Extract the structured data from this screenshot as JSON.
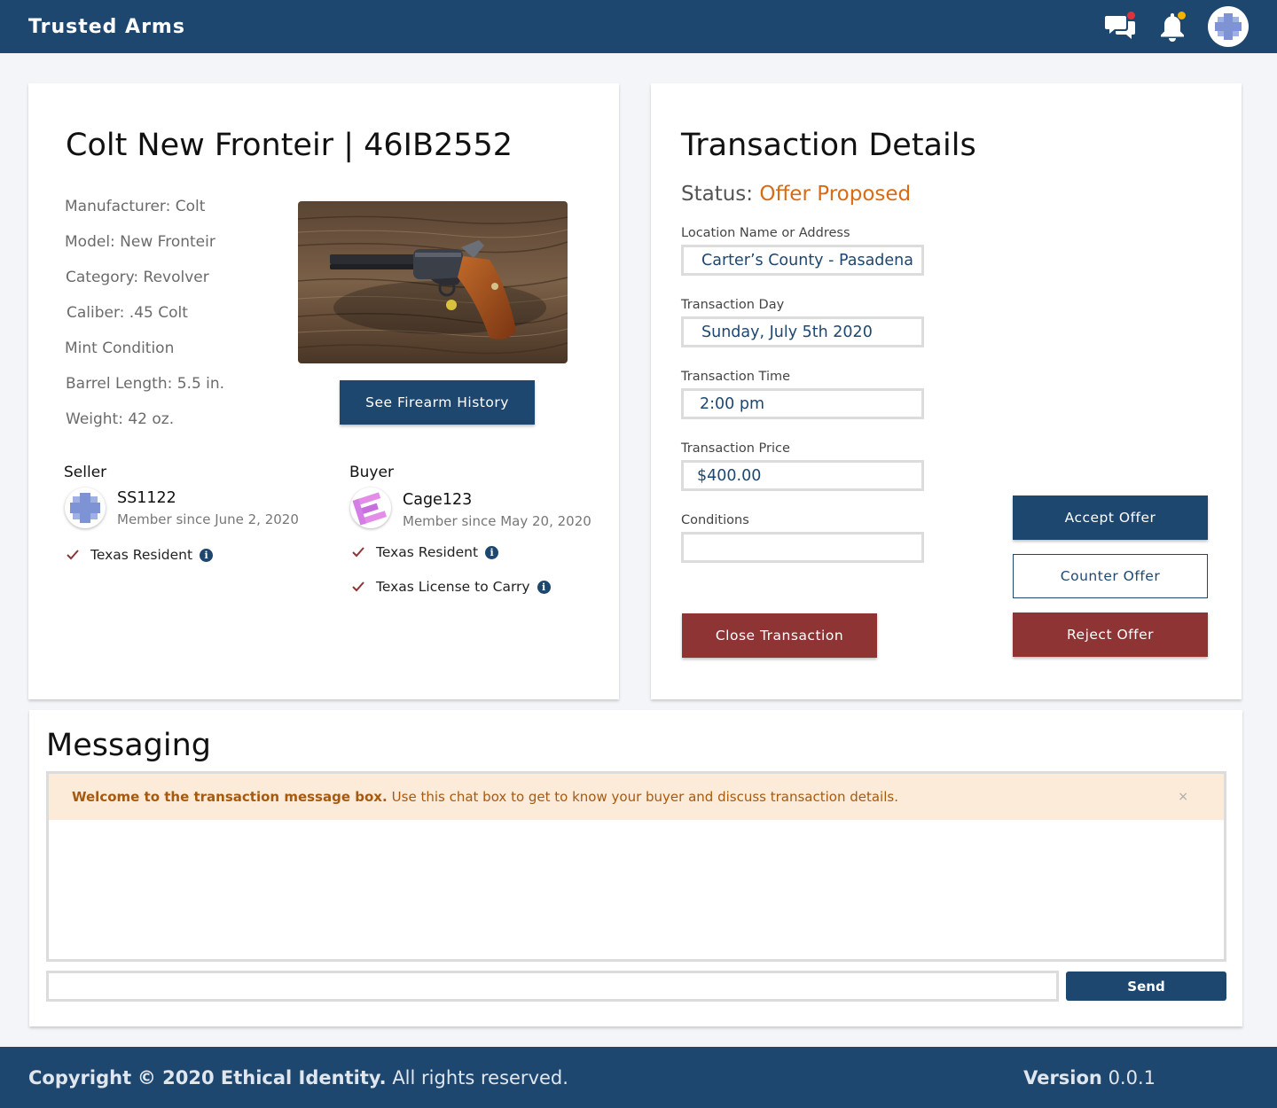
{
  "header": {
    "brand": "Trusted Arms",
    "icons": [
      "chat-icon",
      "bell-icon",
      "user-avatar"
    ],
    "colors": {
      "bar": "#1e4770",
      "chat_dot": "#e0323c",
      "bell_dot": "#f2b300"
    }
  },
  "firearm": {
    "title": "Colt New Fronteir | 46IB2552",
    "specs": [
      "Manufacturer: Colt",
      "Model: New Fronteir",
      "Category: Revolver",
      "Caliber: .45 Colt",
      "Mint Condition",
      "Barrel Length: 5.5 in.",
      "Weight: 42 oz."
    ],
    "history_button": "See Firearm History"
  },
  "seller": {
    "label": "Seller",
    "name": "SS1122",
    "since": "Member since June 2, 2020",
    "checks": [
      {
        "label": "Texas Resident",
        "checked": true
      }
    ]
  },
  "buyer": {
    "label": "Buyer",
    "name": "Cage123",
    "since": "Member since May 20, 2020",
    "checks": [
      {
        "label": "Texas Resident",
        "checked": true
      },
      {
        "label": "Texas License to Carry",
        "checked": true
      }
    ]
  },
  "transaction": {
    "title": "Transaction Details",
    "status_label": "Status:",
    "status_value": "Offer Proposed",
    "fields": [
      {
        "label": "Location Name or Address",
        "value": "Carter’s County - Pasadena"
      },
      {
        "label": "Transaction Day",
        "value": "Sunday, July 5th 2020"
      },
      {
        "label": "Transaction Time",
        "value": "2:00 pm"
      },
      {
        "label": "Transaction Price",
        "value": "$400.00"
      },
      {
        "label": "Conditions",
        "value": ""
      }
    ],
    "buttons": {
      "accept": "Accept Offer",
      "counter": "Counter Offer",
      "reject": "Reject Offer",
      "close": "Close Transaction"
    },
    "colors": {
      "status": "#d96b14",
      "danger": "#8e3434"
    }
  },
  "messaging": {
    "title": "Messaging",
    "alert_bold": "Welcome to the transaction message box.",
    "alert_text": "Use this chat box to get to know your buyer and discuss transaction details.",
    "alert_close": "×",
    "send": "Send"
  },
  "footer": {
    "copyright_label": "Copyright",
    "copyright_company": "© 2020 Ethical Identity.",
    "copyright_rest": "All rights reserved.",
    "version_label": "Version",
    "version_value": "0.0.1"
  }
}
